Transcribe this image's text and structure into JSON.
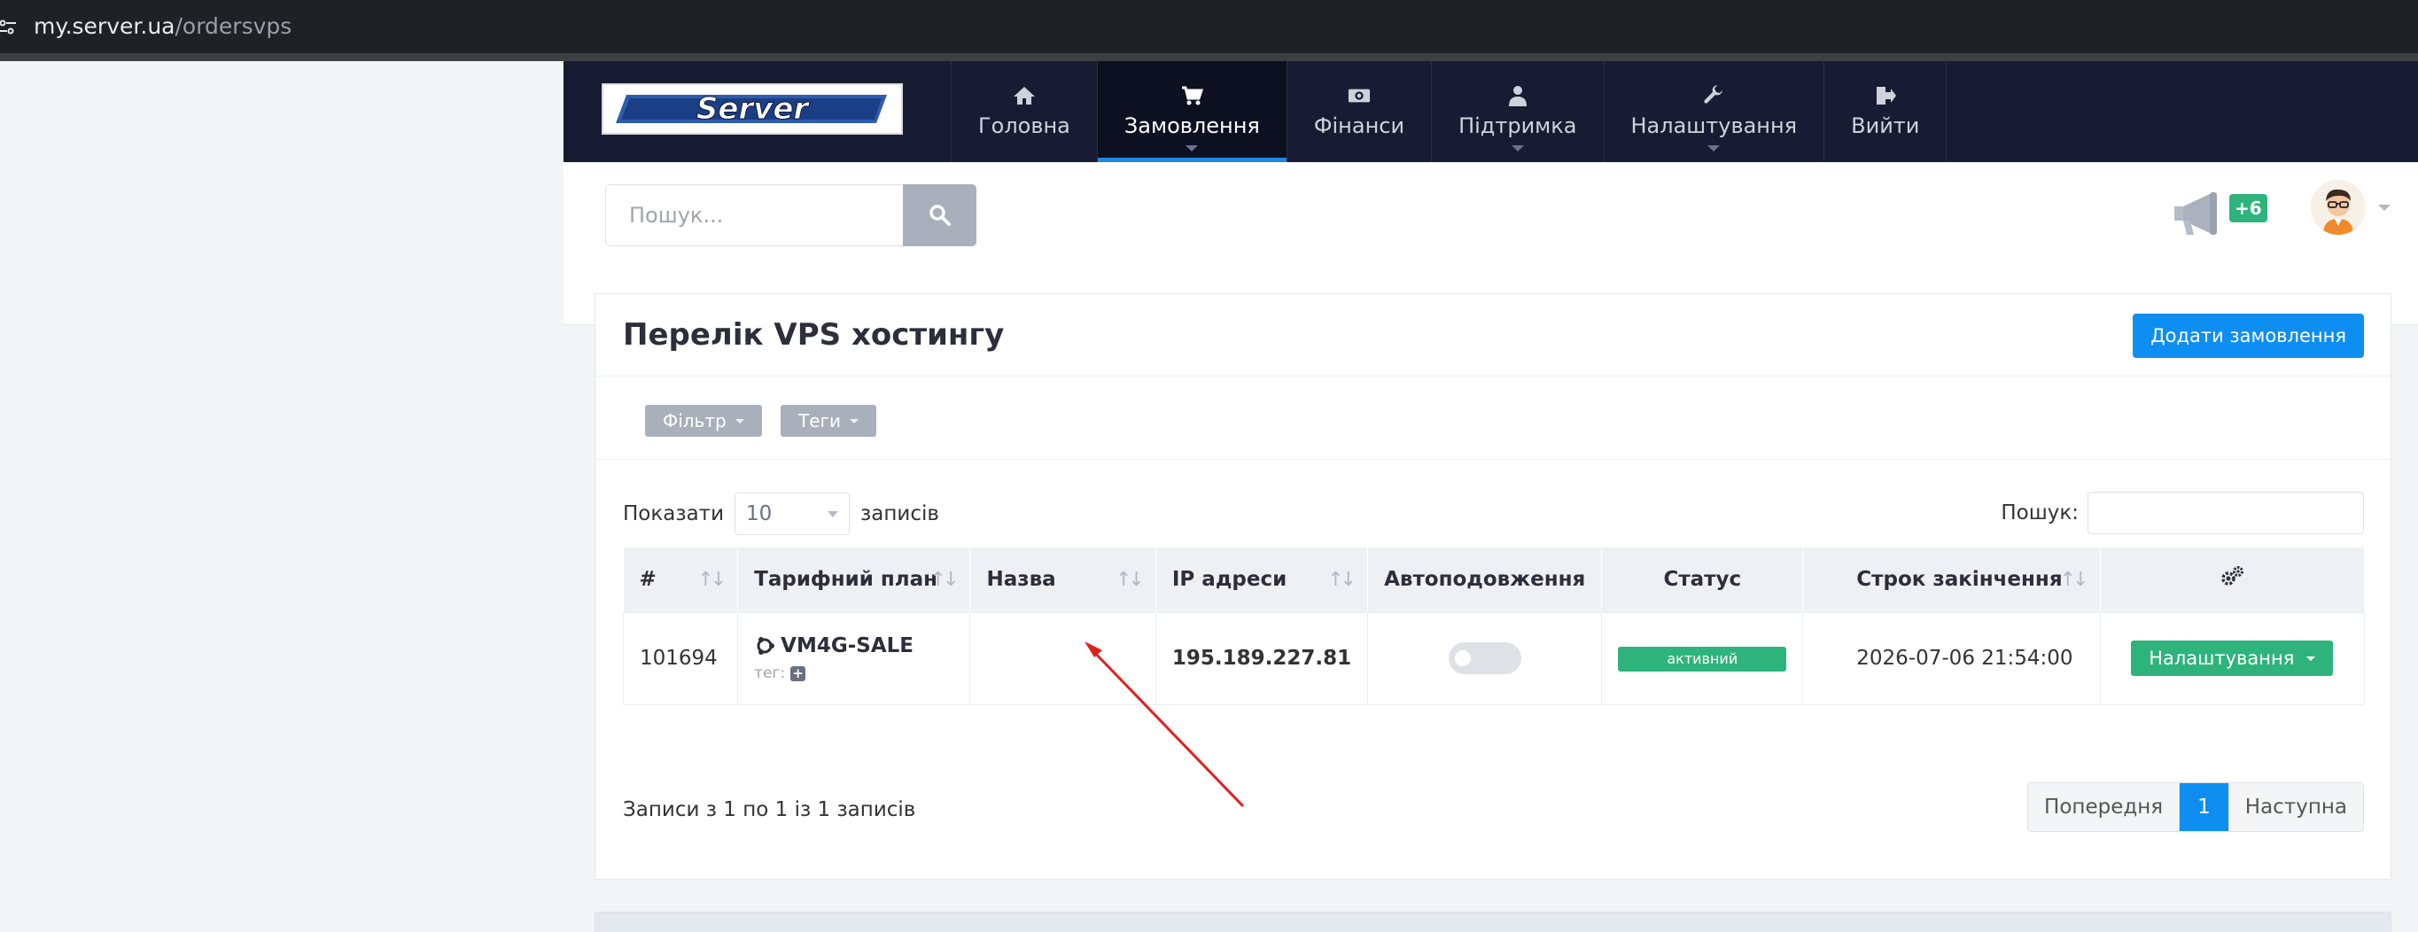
{
  "browser": {
    "url_host": "my.server.ua",
    "url_path": "/ordersvps"
  },
  "nav": {
    "logo_text": "Server",
    "items": [
      {
        "label": "Головна",
        "icon": "home-icon",
        "active": false,
        "caret": false
      },
      {
        "label": "Замовлення",
        "icon": "cart-icon",
        "active": true,
        "caret": true
      },
      {
        "label": "Фінанси",
        "icon": "money-icon",
        "active": false,
        "caret": false
      },
      {
        "label": "Підтримка",
        "icon": "support-user-icon",
        "active": false,
        "caret": true
      },
      {
        "label": "Налаштування",
        "icon": "wrench-icon",
        "active": false,
        "caret": true
      },
      {
        "label": "Вийти",
        "icon": "logout-icon",
        "active": false,
        "caret": false
      }
    ]
  },
  "search": {
    "placeholder": "Пошук..."
  },
  "notifications": {
    "badge": "+6"
  },
  "card": {
    "title": "Перелік VPS хостингу",
    "add_button": "Додати замовлення",
    "filter_label": "Фільтр",
    "tags_label": "Теги",
    "show_label": "Показати",
    "page_length": "10",
    "records_label": "записів",
    "table_search_label": "Пошук:",
    "table_search_value": ""
  },
  "table": {
    "columns": [
      "#",
      "Тарифний план",
      "Назва",
      "IP адреси",
      "Автоподовження",
      "Статус",
      "Строк закінчення",
      "settings-gears-icon"
    ],
    "rows": [
      {
        "id": "101694",
        "plan": "VM4G-SALE",
        "tag_label": "тег:",
        "name": "",
        "ip": "195.189.227.81",
        "autorenew": false,
        "status": "активний",
        "expires": "2026-07-06 21:54:00",
        "action": "Налаштування"
      }
    ]
  },
  "footer": {
    "info": "Записи з 1 по 1 із 1 записів",
    "prev": "Попередня",
    "current_page": "1",
    "next": "Наступна"
  },
  "colors": {
    "nav_bg": "#181c32",
    "accent_blue": "#0f8ef2",
    "success_green": "#2fb37c",
    "annotation_red": "#e02020"
  }
}
